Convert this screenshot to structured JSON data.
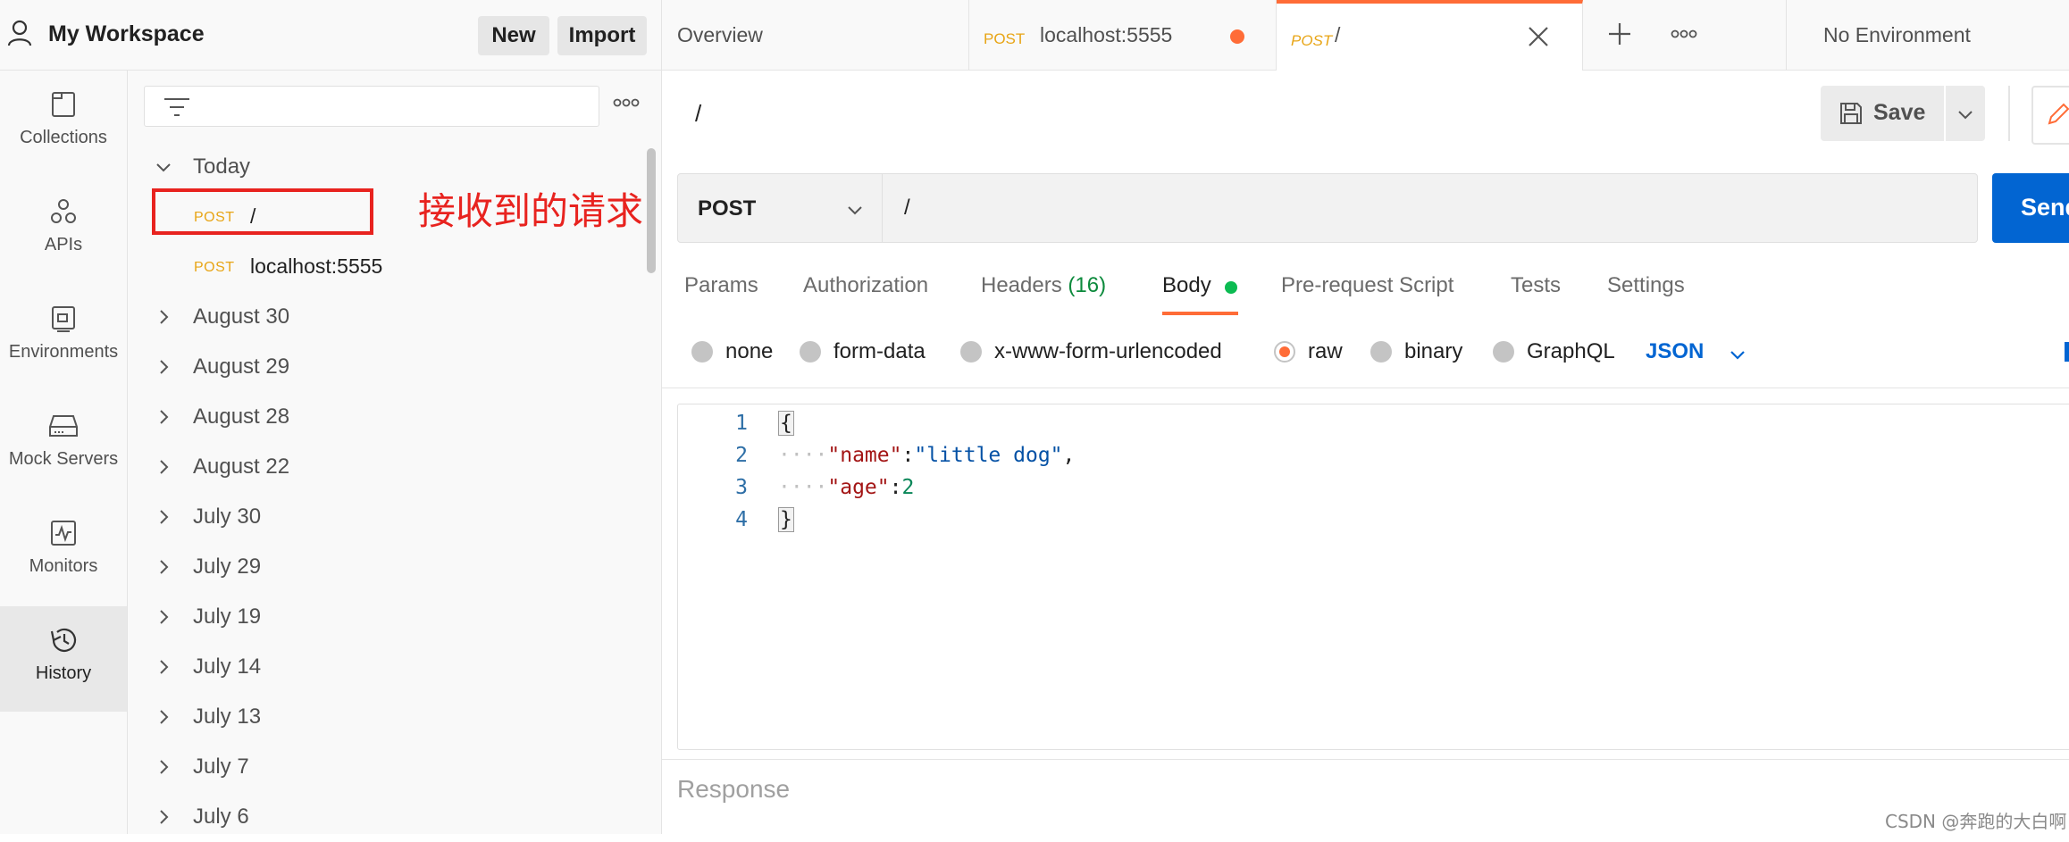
{
  "workspace": {
    "title": "My Workspace",
    "new_label": "New",
    "import_label": "Import"
  },
  "leftnav": {
    "items": [
      {
        "label": "Collections",
        "icon": "collections-icon"
      },
      {
        "label": "APIs",
        "icon": "apis-icon"
      },
      {
        "label": "Environments",
        "icon": "environments-icon"
      },
      {
        "label": "Mock Servers",
        "icon": "mock-servers-icon"
      },
      {
        "label": "Monitors",
        "icon": "monitors-icon"
      },
      {
        "label": "History",
        "icon": "history-icon",
        "active": true
      }
    ]
  },
  "sidebar": {
    "today_label": "Today",
    "today_requests": [
      {
        "method": "POST",
        "url": "/"
      },
      {
        "method": "POST",
        "url": "localhost:5555"
      }
    ],
    "groups": [
      "August 30",
      "August 29",
      "August 28",
      "August 22",
      "July 30",
      "July 29",
      "July 19",
      "July 14",
      "July 13",
      "July 7",
      "July 6"
    ]
  },
  "annotation": {
    "text": "接收到的请求",
    "color": "#e8231f"
  },
  "tabs": {
    "overview_label": "Overview",
    "tab1_method": "POST",
    "tab1_url": "localhost:5555",
    "tab2_method": "POST",
    "tab2_url": "/",
    "environment_label": "No Environment"
  },
  "request": {
    "title": "/",
    "save_label": "Save",
    "method": "POST",
    "url": "/",
    "send_label": "Send"
  },
  "request_tabs": {
    "params": "Params",
    "authorization": "Authorization",
    "headers": "Headers",
    "headers_count": "(16)",
    "body": "Body",
    "prerequest": "Pre-request Script",
    "tests": "Tests",
    "settings": "Settings"
  },
  "body_types": {
    "options": [
      "none",
      "form-data",
      "x-www-form-urlencoded",
      "raw",
      "binary",
      "GraphQL"
    ],
    "selected": "raw",
    "format": "JSON"
  },
  "editor": {
    "line_numbers": [
      "1",
      "2",
      "3",
      "4"
    ],
    "open_brace": "{",
    "line2_key": "\"name\"",
    "line2_value": "\"little dog\"",
    "line3_key": "\"age\"",
    "line3_value": "2",
    "close_brace": "}"
  },
  "response": {
    "label": "Response"
  },
  "watermark": "CSDN @奔跑的大白啊",
  "colors": {
    "accent": "#ff6c37",
    "primary": "#0265d2",
    "method_post": "#e8a516",
    "highlight": "#e8231f"
  }
}
